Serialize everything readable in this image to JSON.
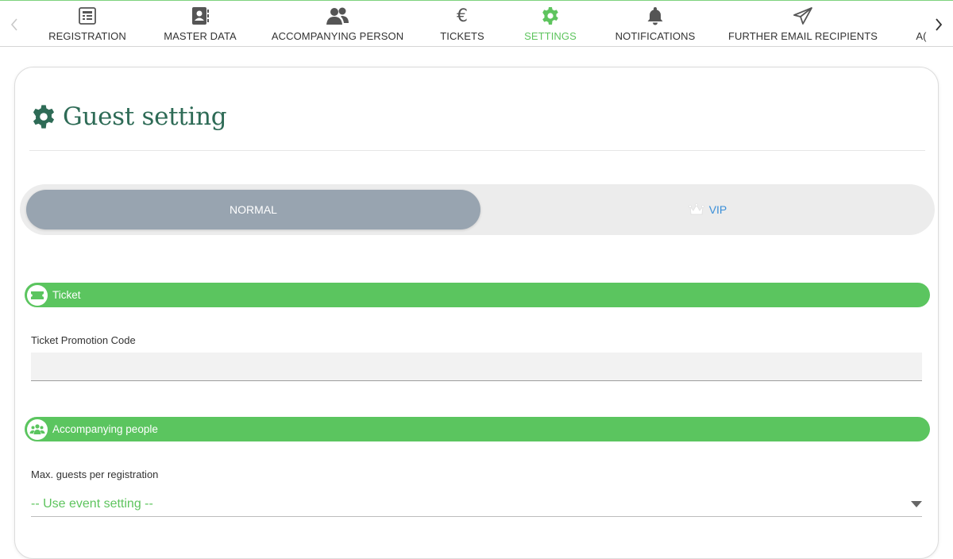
{
  "tabs": [
    {
      "label": "REGISTRATION",
      "icon": "registration-form-icon"
    },
    {
      "label": "MASTER DATA",
      "icon": "contact-book-icon"
    },
    {
      "label": "ACCOMPANYING PERSON",
      "icon": "users-icon"
    },
    {
      "label": "TICKETS",
      "icon": "euro-icon"
    },
    {
      "label": "SETTINGS",
      "icon": "gear-icon",
      "active": true
    },
    {
      "label": "NOTIFICATIONS",
      "icon": "bell-icon"
    },
    {
      "label": "FURTHER EMAIL RECIPIENTS",
      "icon": "paper-plane-icon"
    },
    {
      "label": "A(",
      "icon": "",
      "truncated": true
    }
  ],
  "page": {
    "title": "Guest setting"
  },
  "guest_type_toggle": {
    "options": [
      "NORMAL",
      "VIP"
    ],
    "selected": "NORMAL"
  },
  "sections": {
    "ticket": {
      "title": "Ticket",
      "promo_label": "Ticket Promotion Code",
      "promo_value": ""
    },
    "accompanying": {
      "title": "Accompanying people",
      "max_guests_label": "Max. guests per registration",
      "max_guests_value": "-- Use event setting --"
    }
  },
  "colors": {
    "accent_green": "#5bc55f",
    "title_green": "#2e6b56",
    "vip_blue": "#3b8fd8",
    "toggle_selected": "#98a4b0"
  }
}
